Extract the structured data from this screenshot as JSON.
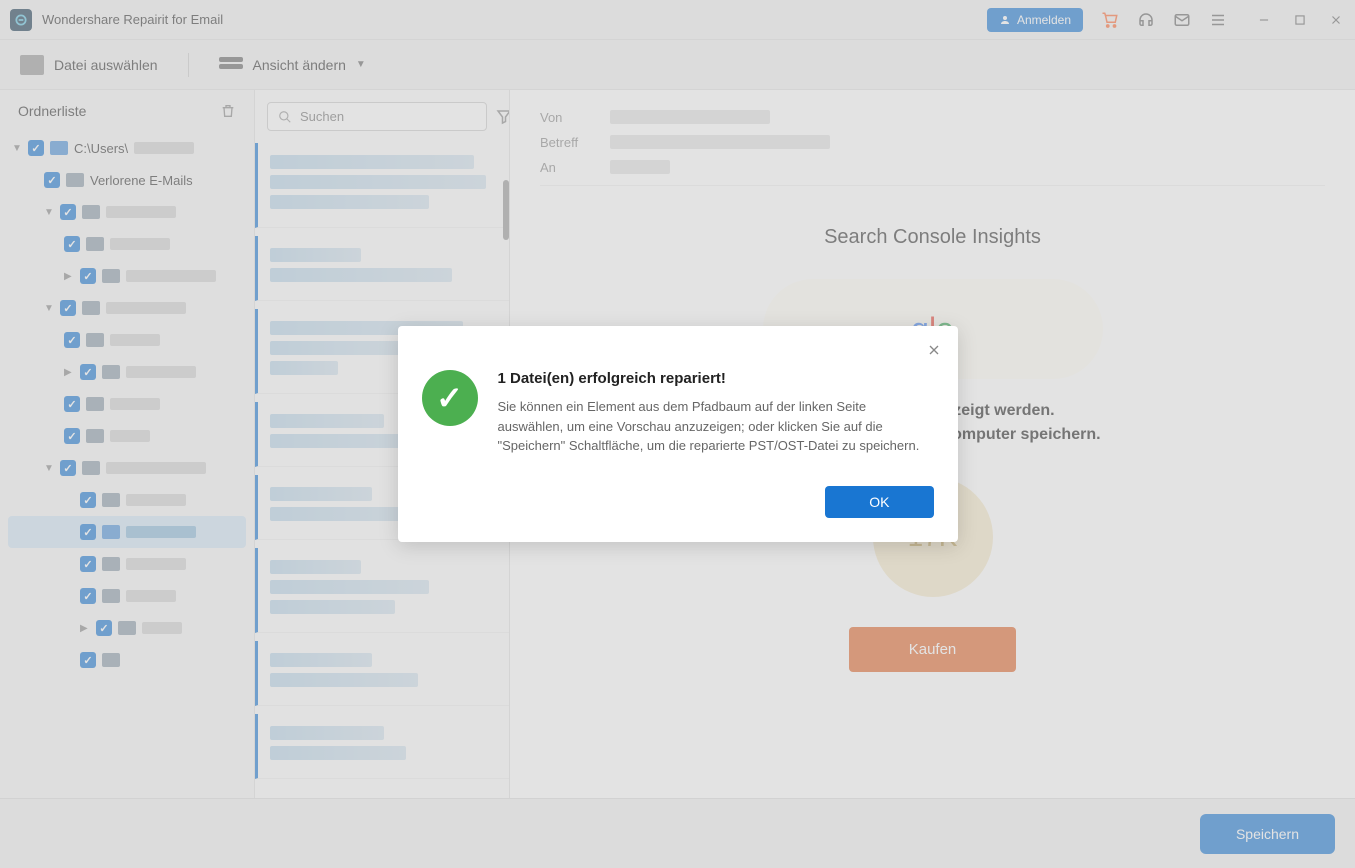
{
  "app": {
    "title": "Wondershare Repairit for Email"
  },
  "titlebar": {
    "login": "Anmelden"
  },
  "toolbar": {
    "select_file": "Datei auswählen",
    "change_view": "Ansicht ändern"
  },
  "sidebar": {
    "title": "Ordnerliste",
    "root_path": "C:\\Users\\",
    "lost_emails": "Verlorene E-Mails"
  },
  "search": {
    "placeholder": "Suchen"
  },
  "preview": {
    "from_label": "Von",
    "subject_label": "Betreff",
    "to_label": "An",
    "insights_title": "Search Console Insights",
    "text_line1": "der Vorschau angezeigt werden.",
    "text_line2": "Sie die Datei auf Ihrem Computer speichern.",
    "badge_value": "17K",
    "buy": "Kaufen"
  },
  "bottom": {
    "save": "Speichern"
  },
  "modal": {
    "title": "1 Datei(en) erfolgreich repariert!",
    "body": "Sie können ein Element aus dem Pfadbaum auf der linken Seite auswählen, um eine Vorschau anzuzeigen; oder klicken Sie auf die \"Speichern\" Schaltfläche, um die reparierte PST/OST-Datei zu speichern.",
    "ok": "OK"
  }
}
